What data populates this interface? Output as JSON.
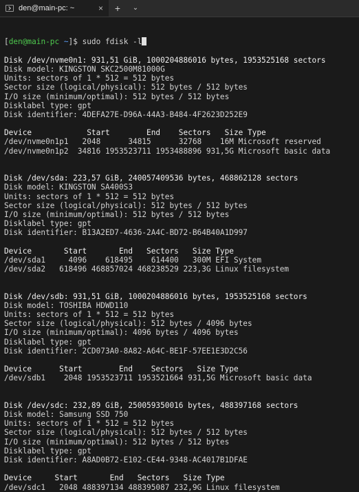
{
  "window": {
    "tab_title": "den@main-pc: ~",
    "new_tab": "+",
    "dropdown": "⌄",
    "close": "×"
  },
  "terminal": {
    "prompt_open": "[",
    "prompt_user": "den@main-pc",
    "prompt_path": " ~",
    "prompt_close": "]$ ",
    "command": "sudo fdisk -l",
    "lines": [
      {
        "t": "Disk /dev/nvme0n1: 931,51 GiB, 1000204886016 bytes, 1953525168 sectors",
        "c": "hdr"
      },
      {
        "t": "Disk model: KINGSTON SKC2500M81000G",
        "c": ""
      },
      {
        "t": "Units: sectors of 1 * 512 = 512 bytes",
        "c": ""
      },
      {
        "t": "Sector size (logical/physical): 512 bytes / 512 bytes",
        "c": ""
      },
      {
        "t": "I/O size (minimum/optimal): 512 bytes / 512 bytes",
        "c": ""
      },
      {
        "t": "Disklabel type: gpt",
        "c": ""
      },
      {
        "t": "Disk identifier: 4DEFA27E-D96A-44A3-B484-4F2623D252E9",
        "c": ""
      },
      {
        "t": "",
        "c": "blank"
      },
      {
        "t": "Device            Start        End    Sectors   Size Type",
        "c": "hdr"
      },
      {
        "t": "/dev/nvme0n1p1   2048      34815      32768    16M Microsoft reserved",
        "c": ""
      },
      {
        "t": "/dev/nvme0n1p2  34816 1953523711 1953488896 931,5G Microsoft basic data",
        "c": ""
      },
      {
        "t": "",
        "c": "blank"
      },
      {
        "t": "",
        "c": "blank"
      },
      {
        "t": "Disk /dev/sda: 223,57 GiB, 240057409536 bytes, 468862128 sectors",
        "c": "hdr"
      },
      {
        "t": "Disk model: KINGSTON SA400S3",
        "c": ""
      },
      {
        "t": "Units: sectors of 1 * 512 = 512 bytes",
        "c": ""
      },
      {
        "t": "Sector size (logical/physical): 512 bytes / 512 bytes",
        "c": ""
      },
      {
        "t": "I/O size (minimum/optimal): 512 bytes / 512 bytes",
        "c": ""
      },
      {
        "t": "Disklabel type: gpt",
        "c": ""
      },
      {
        "t": "Disk identifier: B13A2ED7-4636-2A4C-BD72-B64B40A1D997",
        "c": ""
      },
      {
        "t": "",
        "c": "blank"
      },
      {
        "t": "Device       Start       End   Sectors   Size Type",
        "c": "hdr"
      },
      {
        "t": "/dev/sda1     4096    618495    614400   300M EFI System",
        "c": ""
      },
      {
        "t": "/dev/sda2   618496 468857024 468238529 223,3G Linux filesystem",
        "c": ""
      },
      {
        "t": "",
        "c": "blank"
      },
      {
        "t": "",
        "c": "blank"
      },
      {
        "t": "Disk /dev/sdb: 931,51 GiB, 1000204886016 bytes, 1953525168 sectors",
        "c": "hdr"
      },
      {
        "t": "Disk model: TOSHIBA HDWD110",
        "c": ""
      },
      {
        "t": "Units: sectors of 1 * 512 = 512 bytes",
        "c": ""
      },
      {
        "t": "Sector size (logical/physical): 512 bytes / 4096 bytes",
        "c": ""
      },
      {
        "t": "I/O size (minimum/optimal): 4096 bytes / 4096 bytes",
        "c": ""
      },
      {
        "t": "Disklabel type: gpt",
        "c": ""
      },
      {
        "t": "Disk identifier: 2CD073A0-8A82-A64C-BE1F-57EE1E3D2C56",
        "c": ""
      },
      {
        "t": "",
        "c": "blank"
      },
      {
        "t": "Device      Start        End    Sectors   Size Type",
        "c": "hdr"
      },
      {
        "t": "/dev/sdb1    2048 1953523711 1953521664 931,5G Microsoft basic data",
        "c": ""
      },
      {
        "t": "",
        "c": "blank"
      },
      {
        "t": "",
        "c": "blank"
      },
      {
        "t": "Disk /dev/sdc: 232,89 GiB, 250059350016 bytes, 488397168 sectors",
        "c": "hdr"
      },
      {
        "t": "Disk model: Samsung SSD 750",
        "c": ""
      },
      {
        "t": "Units: sectors of 1 * 512 = 512 bytes",
        "c": ""
      },
      {
        "t": "Sector size (logical/physical): 512 bytes / 512 bytes",
        "c": ""
      },
      {
        "t": "I/O size (minimum/optimal): 512 bytes / 512 bytes",
        "c": ""
      },
      {
        "t": "Disklabel type: gpt",
        "c": ""
      },
      {
        "t": "Disk identifier: A8AD0B72-E102-CE44-9348-AC4017B1DFAE",
        "c": ""
      },
      {
        "t": "",
        "c": "blank"
      },
      {
        "t": "Device     Start       End   Sectors   Size Type",
        "c": "hdr"
      },
      {
        "t": "/dev/sdc1   2048 488397134 488395087 232,9G Linux filesystem",
        "c": ""
      }
    ]
  },
  "colors": {
    "background": "#1a1a1a",
    "prompt_user": "#4ec94e",
    "prompt_path": "#5a9cf5",
    "text": "#d4d4d4"
  }
}
